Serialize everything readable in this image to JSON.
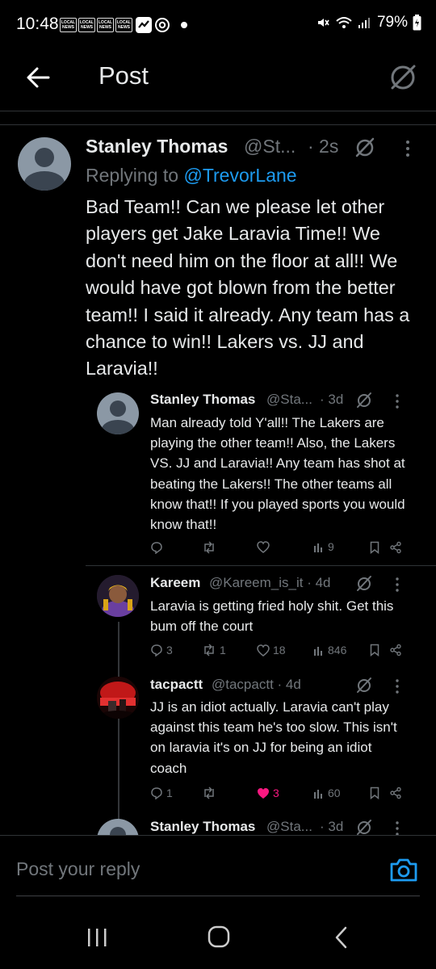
{
  "status_bar": {
    "time": "10:48",
    "news_badges": [
      [
        "LOCAL",
        "NEWS"
      ],
      [
        "LOCAL",
        "NEWS"
      ],
      [
        "LOCAL",
        "NEWS"
      ],
      [
        "LOCAL",
        "NEWS"
      ]
    ],
    "battery": "79%"
  },
  "header": {
    "title": "Post"
  },
  "main_post": {
    "name": "Stanley Thomas",
    "handle": "@St...",
    "time": "· 2s",
    "replying_prefix": "Replying to ",
    "replying_to": "@TrevorLane",
    "text": "Bad Team!! Can we please let other players get Jake Laravia Time!! We don't need him on the floor at all!! We would have got blown from the better team!!  I said it already. Any team has a chance to win!! Lakers vs. JJ and Laravia!!"
  },
  "quoted_reply": {
    "name": "Stanley Thomas",
    "handle": "@Sta...",
    "time": "· 3d",
    "text": "Man already told Y'all!! The Lakers are playing the other team!! Also, the Lakers VS. JJ and Laravia!! Any team has shot at beating the Lakers!! The other teams all know that!! If you played sports you would know that!!",
    "replies": "",
    "reposts": "",
    "likes": "",
    "views": "9"
  },
  "replies": [
    {
      "name": "Kareem",
      "handle": "@Kareem_is_it · 4d",
      "text": "Laravia is getting fried holy shit. Get this bum off the court",
      "replies": "3",
      "reposts": "1",
      "likes": "18",
      "views": "846",
      "liked": false
    },
    {
      "name": "tacpactt",
      "handle": "@tacpactt · 4d",
      "text": "JJ is an idiot actually. Laravia can't play against this team he's too slow. This isn't on laravia it's on JJ for being an idiot coach",
      "replies": "1",
      "reposts": "",
      "likes": "3",
      "views": "60",
      "liked": true
    },
    {
      "name": "Stanley Thomas",
      "handle": "@Sta...",
      "time": "· 3d"
    }
  ],
  "reply_bar": {
    "placeholder": "Post your reply"
  },
  "colors": {
    "background": "#000000",
    "text": "#e7e9ea",
    "secondary": "#71767b",
    "link": "#1d9bf0",
    "like": "#f91880"
  }
}
